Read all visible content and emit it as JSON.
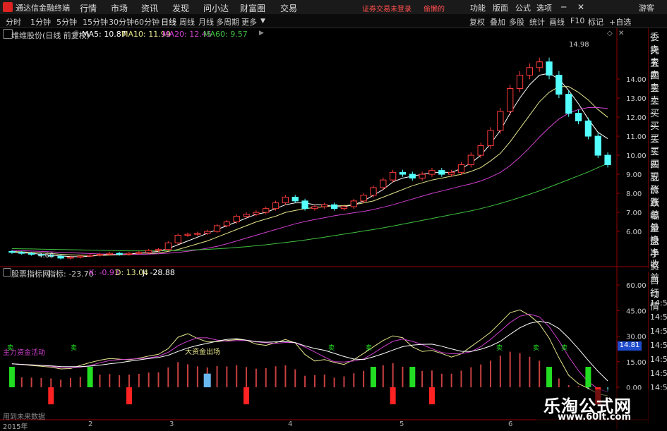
{
  "menubar": {
    "title": "通达信金融终端",
    "menu": [
      "行情",
      "市场",
      "资讯",
      "发现",
      "问小达",
      "财富圈",
      "交易"
    ],
    "login_notice": "证券交易未登录",
    "brand": "偷懒的",
    "right_items": [
      "功能",
      "版面",
      "公式",
      "选项"
    ],
    "guest": "游客"
  },
  "periodbar": {
    "periods": [
      "分时",
      "1分钟",
      "5分钟",
      "15分钟",
      "30分钟",
      "60分钟",
      "日线",
      "周线",
      "月线",
      "多周期",
      "更多"
    ],
    "active_period": "日线",
    "tools": [
      "复权",
      "叠加",
      "多股",
      "统计",
      "画线",
      "F10",
      "标记",
      "+自选"
    ]
  },
  "main_info": {
    "stock": "维维股份(日线 前复权)",
    "ma5": "MA5: 10.87",
    "ma10": "MA10: 11.99",
    "ma20": "MA20: 12.45",
    "ma60": "MA60: 9.57"
  },
  "colors": {
    "up": "#ff3b3b",
    "down": "#54ffff",
    "ma5": "#ffffff",
    "ma10": "#e6e68c",
    "ma20": "#d040d0",
    "ma60": "#40c040",
    "buy": "#22dd22",
    "sell": "#ff2222",
    "axis_frame": "#990000"
  },
  "price_axis": {
    "labels": [
      "14.00",
      "13.00",
      "12.00",
      "11.00",
      "10.00",
      "9.00",
      "8.00",
      "7.00",
      "6.00"
    ],
    "values": [
      14,
      13,
      12,
      11,
      10,
      9,
      8,
      7,
      6
    ],
    "high_label": "14.98",
    "low_label": "4.60"
  },
  "right_panel": {
    "items": [
      "委托",
      "卖五",
      "卖四",
      "卖三",
      "卖二",
      "卖一",
      "买一",
      "买二",
      "买三",
      "买四",
      "买五",
      "现价",
      "涨跌",
      "涨幅",
      "总量",
      "外盘",
      "换手",
      "净资",
      "收益"
    ]
  },
  "indicator": {
    "name": "股票指标网",
    "main_label": "指标: -23.70",
    "k": "K: -0.93",
    "d": "D: 13.04",
    "j": "J: -28.88",
    "axis_labels": [
      "60.00",
      "45.00",
      "30.00",
      "15.00",
      "0.00"
    ],
    "axis_values": [
      60,
      45,
      30,
      15,
      0
    ],
    "current": "14.81",
    "annotations": [
      "主力资金活动",
      "大资金出场",
      "卖",
      "卖",
      "卖",
      "卖",
      "卖",
      "卖",
      "卖"
    ]
  },
  "indicator_side": {
    "items": [
      "自动",
      "行情",
      "14:50",
      "14:50",
      "14:50",
      "14:50",
      "14:50",
      "14:50",
      "14:5"
    ]
  },
  "time_axis": {
    "labels": [
      "2015年",
      "2",
      "3",
      "4",
      "5",
      "6"
    ]
  },
  "status": {
    "text": "用到未来数据"
  },
  "watermark": {
    "title": "乐淘公式网",
    "url": "www.60lt.com"
  },
  "chart_data": {
    "type": "candlestick",
    "series": [
      {
        "name": "K线 收盘",
        "values": [
          4.9,
          4.85,
          4.8,
          4.75,
          4.7,
          4.6,
          4.65,
          4.7,
          4.75,
          4.8,
          4.85,
          4.8,
          4.85,
          4.9,
          5.0,
          5.05,
          5.4,
          5.8,
          5.85,
          5.9,
          6.0,
          6.3,
          6.5,
          6.8,
          6.9,
          7.0,
          7.2,
          7.5,
          7.8,
          7.6,
          7.2,
          7.3,
          7.4,
          7.2,
          7.3,
          7.6,
          7.9,
          8.3,
          8.7,
          9.1,
          9.0,
          8.8,
          9.0,
          9.2,
          9.0,
          9.1,
          9.5,
          10.0,
          10.5,
          11.3,
          12.3,
          13.5,
          14.2,
          14.6,
          14.9,
          14.2,
          13.2,
          12.2,
          11.8,
          11.0,
          10.0,
          9.5
        ]
      },
      {
        "name": "MA5",
        "values": [
          4.9,
          4.88,
          4.85,
          4.8,
          4.75,
          4.72,
          4.68,
          4.67,
          4.7,
          4.75,
          4.8,
          4.8,
          4.83,
          4.85,
          4.9,
          4.95,
          5.1,
          5.3,
          5.5,
          5.7,
          5.9,
          6.1,
          6.3,
          6.5,
          6.7,
          6.9,
          7.0,
          7.2,
          7.4,
          7.5,
          7.5,
          7.4,
          7.4,
          7.3,
          7.3,
          7.4,
          7.6,
          7.9,
          8.2,
          8.6,
          8.8,
          8.9,
          9.0,
          9.1,
          9.1,
          9.1,
          9.3,
          9.6,
          10.0,
          10.6,
          11.3,
          12.2,
          13.0,
          13.7,
          14.2,
          14.3,
          14.0,
          13.4,
          12.7,
          11.9,
          11.2,
          10.87
        ]
      },
      {
        "name": "MA10",
        "values": [
          4.95,
          4.93,
          4.9,
          4.87,
          4.84,
          4.8,
          4.77,
          4.75,
          4.74,
          4.74,
          4.76,
          4.77,
          4.79,
          4.8,
          4.83,
          4.87,
          4.95,
          5.05,
          5.2,
          5.35,
          5.5,
          5.7,
          5.9,
          6.1,
          6.3,
          6.5,
          6.65,
          6.8,
          7.0,
          7.1,
          7.2,
          7.25,
          7.3,
          7.35,
          7.35,
          7.4,
          7.5,
          7.6,
          7.8,
          8.0,
          8.2,
          8.4,
          8.55,
          8.7,
          8.8,
          8.9,
          9.0,
          9.15,
          9.35,
          9.7,
          10.1,
          10.7,
          11.4,
          12.1,
          12.8,
          13.3,
          13.6,
          13.6,
          13.3,
          12.9,
          12.4,
          11.99
        ]
      },
      {
        "name": "MA20",
        "values": [
          5.0,
          4.99,
          4.97,
          4.95,
          4.93,
          4.9,
          4.88,
          4.86,
          4.84,
          4.82,
          4.81,
          4.8,
          4.8,
          4.8,
          4.81,
          4.83,
          4.86,
          4.9,
          4.96,
          5.03,
          5.12,
          5.22,
          5.35,
          5.5,
          5.65,
          5.8,
          5.95,
          6.1,
          6.25,
          6.4,
          6.52,
          6.62,
          6.72,
          6.82,
          6.9,
          6.98,
          7.05,
          7.15,
          7.27,
          7.4,
          7.55,
          7.7,
          7.85,
          8.0,
          8.12,
          8.25,
          8.38,
          8.5,
          8.65,
          8.85,
          9.1,
          9.45,
          9.9,
          10.4,
          10.95,
          11.45,
          11.9,
          12.2,
          12.4,
          12.5,
          12.5,
          12.45
        ]
      },
      {
        "name": "MA60",
        "values": [
          5.1,
          5.09,
          5.08,
          5.07,
          5.06,
          5.05,
          5.04,
          5.03,
          5.02,
          5.01,
          5.0,
          4.99,
          4.98,
          4.98,
          4.98,
          4.98,
          4.99,
          5.0,
          5.02,
          5.04,
          5.06,
          5.09,
          5.12,
          5.16,
          5.2,
          5.25,
          5.3,
          5.36,
          5.42,
          5.48,
          5.55,
          5.62,
          5.7,
          5.78,
          5.86,
          5.94,
          6.02,
          6.1,
          6.19,
          6.28,
          6.38,
          6.48,
          6.58,
          6.68,
          6.78,
          6.88,
          6.98,
          7.08,
          7.2,
          7.33,
          7.47,
          7.62,
          7.78,
          7.95,
          8.13,
          8.32,
          8.52,
          8.72,
          8.92,
          9.12,
          9.35,
          9.57
        ]
      }
    ],
    "ylim": [
      4.3,
      16.0
    ],
    "indicator_ylim": [
      -12,
      65
    ]
  }
}
